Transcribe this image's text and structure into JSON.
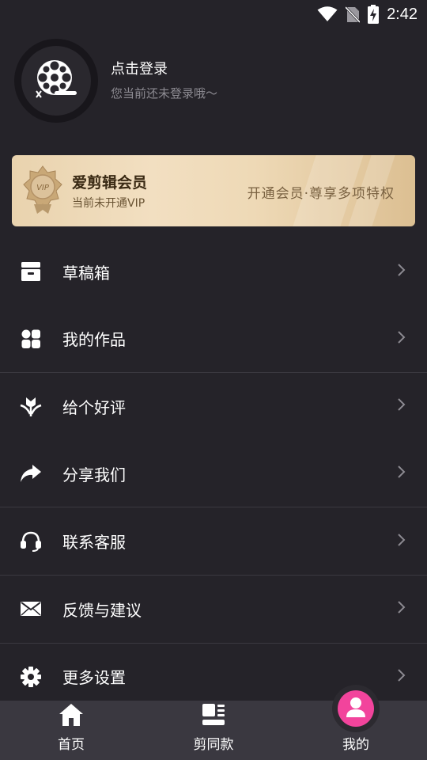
{
  "status_bar": {
    "time": "2:42",
    "icons": [
      "wifi-icon",
      "no-sim-icon",
      "battery-charging-icon"
    ]
  },
  "profile": {
    "login_title": "点击登录",
    "login_subtitle": "您当前还未登录哦～",
    "avatar_icon": "film-reel-icon"
  },
  "vip": {
    "badge_text": "VIP",
    "title": "爱剪辑会员",
    "subtitle": "当前未开通VIP",
    "slogan": "开通会员·尊享多项特权"
  },
  "menu": {
    "items": [
      {
        "label": "草稿箱",
        "icon": "drafts-box-icon"
      },
      {
        "label": "我的作品",
        "icon": "works-grid-icon"
      },
      {
        "label": "给个好评",
        "icon": "flower-rating-icon"
      },
      {
        "label": "分享我们",
        "icon": "share-arrow-icon"
      },
      {
        "label": "联系客服",
        "icon": "headset-icon"
      },
      {
        "label": "反馈与建议",
        "icon": "envelope-icon"
      },
      {
        "label": "更多设置",
        "icon": "gear-icon"
      }
    ]
  },
  "bottom_nav": {
    "items": [
      {
        "label": "首页",
        "icon": "home-icon"
      },
      {
        "label": "剪同款",
        "icon": "template-icon"
      },
      {
        "label": "我的",
        "icon": "user-icon"
      }
    ],
    "active_index": 2,
    "active_color": "#f2449c"
  },
  "colors": {
    "background": "#252329",
    "nav_background": "#3a3840",
    "vip_gold": "#eed9b6",
    "subtext": "#8d8b92"
  }
}
